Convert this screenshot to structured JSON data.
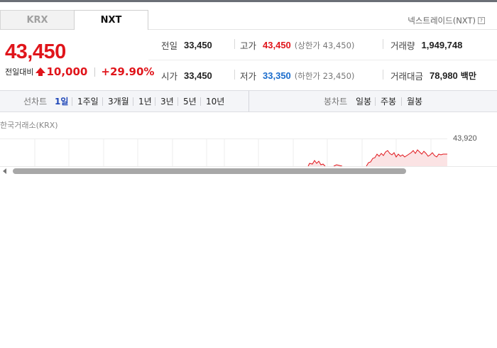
{
  "tabs": [
    {
      "label": "KRX",
      "active": false
    },
    {
      "label": "NXT",
      "active": true
    }
  ],
  "market_label": "넥스트레이드(NXT)",
  "help_glyph": "?",
  "price": {
    "current": "43,450",
    "change_label": "전일대비",
    "change_amount": "10,000",
    "change_percent": "+29.90%",
    "direction": "up"
  },
  "quote": {
    "prev_close": {
      "label": "전일",
      "value": "33,450"
    },
    "high": {
      "label": "고가",
      "value": "43,450",
      "sub": "(상한가 43,450)"
    },
    "volume": {
      "label": "거래량",
      "value": "1,949,748"
    },
    "open": {
      "label": "시가",
      "value": "33,450"
    },
    "low": {
      "label": "저가",
      "value": "33,350",
      "sub": "(하한가 23,450)"
    },
    "amount": {
      "label": "거래대금",
      "value": "78,980",
      "unit": "백만"
    }
  },
  "line_chart_bar": {
    "label": "선차트",
    "items": [
      "1일",
      "1주일",
      "3개월",
      "1년",
      "3년",
      "5년",
      "10년"
    ],
    "active": "1일"
  },
  "candle_chart_bar": {
    "label": "봉차트",
    "items": [
      "일봉",
      "주봉",
      "월봉"
    ]
  },
  "chart": {
    "source_label": "한국거래소(KRX)",
    "max_label": "43,920"
  },
  "colors": {
    "up": "#e0151b",
    "down": "#1a6ccc",
    "active_period": "#1f47b8"
  },
  "icons": {
    "up_arrow": "up-arrow-icon",
    "scroll_left": "scroll-left-arrow-icon"
  }
}
